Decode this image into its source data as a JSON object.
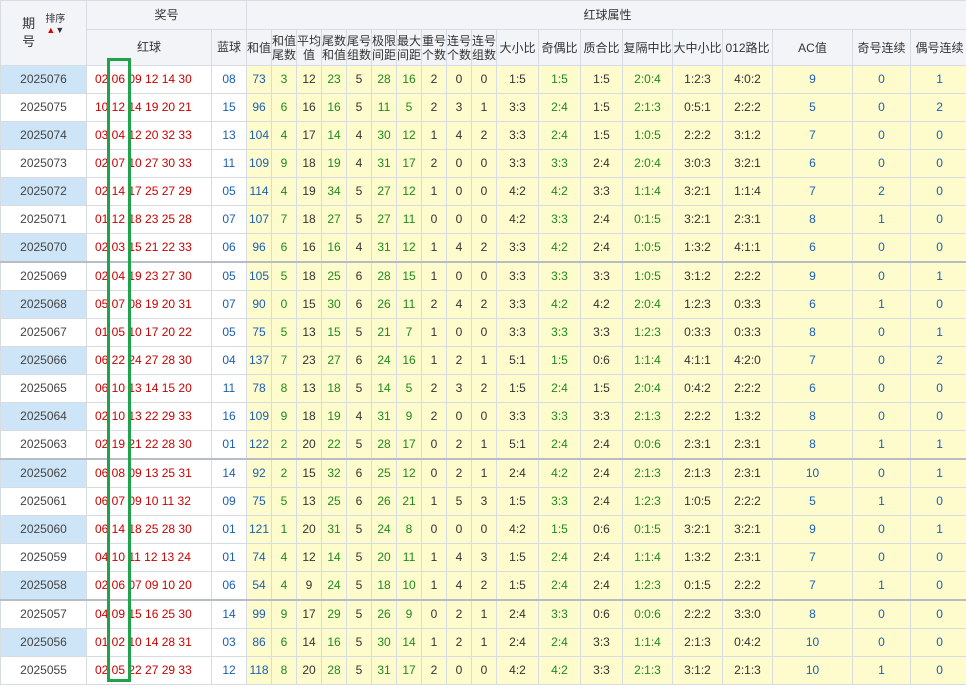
{
  "header": {
    "issue": "期号",
    "sort": "排序",
    "prize": "奖号",
    "red": "红球",
    "blue": "蓝球",
    "attr_group": "红球属性",
    "cols": [
      "和值",
      "和值尾数",
      "平均值",
      "尾数和值",
      "尾号组数",
      "极限间距",
      "最大间距",
      "重号个数",
      "连号个数",
      "连号组数",
      "大小比",
      "奇偶比",
      "质合比",
      "复隔中比",
      "大中小比",
      "012路比",
      "AC值",
      "奇号连续",
      "偶号连续"
    ]
  },
  "rows": [
    {
      "issue": "2025076",
      "red": "02 06 09 12 14 30",
      "blue": "08",
      "attrs": [
        "73",
        "3",
        "12",
        "23",
        "5",
        "28",
        "16",
        "2",
        "0",
        "0",
        "1:5",
        "1:5",
        "1:5",
        "2:0:4",
        "1:2:3",
        "4:0:2",
        "9",
        "0",
        "1"
      ]
    },
    {
      "issue": "2025075",
      "red": "10 12 14 19 20 21",
      "blue": "15",
      "attrs": [
        "96",
        "6",
        "16",
        "16",
        "5",
        "11",
        "5",
        "2",
        "3",
        "1",
        "3:3",
        "2:4",
        "1:5",
        "2:1:3",
        "0:5:1",
        "2:2:2",
        "5",
        "0",
        "2"
      ]
    },
    {
      "issue": "2025074",
      "red": "03 04 12 20 32 33",
      "blue": "13",
      "attrs": [
        "104",
        "4",
        "17",
        "14",
        "4",
        "30",
        "12",
        "1",
        "4",
        "2",
        "3:3",
        "2:4",
        "1:5",
        "1:0:5",
        "2:2:2",
        "3:1:2",
        "7",
        "0",
        "0"
      ]
    },
    {
      "issue": "2025073",
      "red": "02 07 10 27 30 33",
      "blue": "11",
      "attrs": [
        "109",
        "9",
        "18",
        "19",
        "4",
        "31",
        "17",
        "2",
        "0",
        "0",
        "3:3",
        "3:3",
        "2:4",
        "2:0:4",
        "3:0:3",
        "3:2:1",
        "6",
        "0",
        "0"
      ]
    },
    {
      "issue": "2025072",
      "red": "02 14 17 25 27 29",
      "blue": "05",
      "attrs": [
        "114",
        "4",
        "19",
        "34",
        "5",
        "27",
        "12",
        "1",
        "0",
        "0",
        "4:2",
        "4:2",
        "3:3",
        "1:1:4",
        "3:2:1",
        "1:1:4",
        "7",
        "2",
        "0"
      ]
    },
    {
      "issue": "2025071",
      "red": "01 12 18 23 25 28",
      "blue": "07",
      "attrs": [
        "107",
        "7",
        "18",
        "27",
        "5",
        "27",
        "11",
        "0",
        "0",
        "0",
        "4:2",
        "3:3",
        "2:4",
        "0:1:5",
        "3:2:1",
        "2:3:1",
        "8",
        "1",
        "0"
      ]
    },
    {
      "issue": "2025070",
      "red": "02 03 15 21 22 33",
      "blue": "06",
      "attrs": [
        "96",
        "6",
        "16",
        "16",
        "4",
        "31",
        "12",
        "1",
        "4",
        "2",
        "3:3",
        "4:2",
        "2:4",
        "1:0:5",
        "1:3:2",
        "4:1:1",
        "6",
        "0",
        "0"
      ]
    },
    {
      "issue": "2025069",
      "red": "02 04 19 23 27 30",
      "blue": "05",
      "attrs": [
        "105",
        "5",
        "18",
        "25",
        "6",
        "28",
        "15",
        "1",
        "0",
        "0",
        "3:3",
        "3:3",
        "3:3",
        "1:0:5",
        "3:1:2",
        "2:2:2",
        "9",
        "0",
        "1"
      ]
    },
    {
      "issue": "2025068",
      "red": "05 07 08 19 20 31",
      "blue": "07",
      "attrs": [
        "90",
        "0",
        "15",
        "30",
        "6",
        "26",
        "11",
        "2",
        "4",
        "2",
        "3:3",
        "4:2",
        "4:2",
        "2:0:4",
        "1:2:3",
        "0:3:3",
        "6",
        "1",
        "0"
      ]
    },
    {
      "issue": "2025067",
      "red": "01 05 10 17 20 22",
      "blue": "05",
      "attrs": [
        "75",
        "5",
        "13",
        "15",
        "5",
        "21",
        "7",
        "1",
        "0",
        "0",
        "3:3",
        "3:3",
        "3:3",
        "1:2:3",
        "0:3:3",
        "0:3:3",
        "8",
        "0",
        "1"
      ]
    },
    {
      "issue": "2025066",
      "red": "06 22 24 27 28 30",
      "blue": "04",
      "attrs": [
        "137",
        "7",
        "23",
        "27",
        "6",
        "24",
        "16",
        "1",
        "2",
        "1",
        "5:1",
        "1:5",
        "0:6",
        "1:1:4",
        "4:1:1",
        "4:2:0",
        "7",
        "0",
        "2"
      ]
    },
    {
      "issue": "2025065",
      "red": "06 10 13 14 15 20",
      "blue": "11",
      "attrs": [
        "78",
        "8",
        "13",
        "18",
        "5",
        "14",
        "5",
        "2",
        "3",
        "2",
        "1:5",
        "2:4",
        "1:5",
        "2:0:4",
        "0:4:2",
        "2:2:2",
        "6",
        "0",
        "0"
      ]
    },
    {
      "issue": "2025064",
      "red": "02 10 13 22 29 33",
      "blue": "16",
      "attrs": [
        "109",
        "9",
        "18",
        "19",
        "4",
        "31",
        "9",
        "2",
        "0",
        "0",
        "3:3",
        "3:3",
        "3:3",
        "2:1:3",
        "2:2:2",
        "1:3:2",
        "8",
        "0",
        "0"
      ]
    },
    {
      "issue": "2025063",
      "red": "02 19 21 22 28 30",
      "blue": "01",
      "attrs": [
        "122",
        "2",
        "20",
        "22",
        "5",
        "28",
        "17",
        "0",
        "2",
        "1",
        "5:1",
        "2:4",
        "2:4",
        "0:0:6",
        "2:3:1",
        "2:3:1",
        "8",
        "1",
        "1"
      ]
    },
    {
      "issue": "2025062",
      "red": "06 08 09 13 25 31",
      "blue": "14",
      "attrs": [
        "92",
        "2",
        "15",
        "32",
        "6",
        "25",
        "12",
        "0",
        "2",
        "1",
        "2:4",
        "4:2",
        "2:4",
        "2:1:3",
        "2:1:3",
        "2:3:1",
        "10",
        "0",
        "1"
      ]
    },
    {
      "issue": "2025061",
      "red": "06 07 09 10 11 32",
      "blue": "09",
      "attrs": [
        "75",
        "5",
        "13",
        "25",
        "6",
        "26",
        "21",
        "1",
        "5",
        "3",
        "1:5",
        "3:3",
        "2:4",
        "1:2:3",
        "1:0:5",
        "2:2:2",
        "5",
        "1",
        "0"
      ]
    },
    {
      "issue": "2025060",
      "red": "06 14 18 25 28 30",
      "blue": "01",
      "attrs": [
        "121",
        "1",
        "20",
        "31",
        "5",
        "24",
        "8",
        "0",
        "0",
        "0",
        "4:2",
        "1:5",
        "0:6",
        "0:1:5",
        "3:2:1",
        "3:2:1",
        "9",
        "0",
        "1"
      ]
    },
    {
      "issue": "2025059",
      "red": "04 10 11 12 13 24",
      "blue": "01",
      "attrs": [
        "74",
        "4",
        "12",
        "14",
        "5",
        "20",
        "11",
        "1",
        "4",
        "3",
        "1:5",
        "2:4",
        "2:4",
        "1:1:4",
        "1:3:2",
        "2:3:1",
        "7",
        "0",
        "0"
      ]
    },
    {
      "issue": "2025058",
      "red": "02 06 07 09 10 20",
      "blue": "06",
      "attrs": [
        "54",
        "4",
        "9",
        "24",
        "5",
        "18",
        "10",
        "1",
        "4",
        "2",
        "1:5",
        "2:4",
        "2:4",
        "1:2:3",
        "0:1:5",
        "2:2:2",
        "7",
        "1",
        "0"
      ]
    },
    {
      "issue": "2025057",
      "red": "04 09 15 16 25 30",
      "blue": "14",
      "attrs": [
        "99",
        "9",
        "17",
        "29",
        "5",
        "26",
        "9",
        "0",
        "2",
        "1",
        "2:4",
        "3:3",
        "0:6",
        "0:0:6",
        "2:2:2",
        "3:3:0",
        "8",
        "0",
        "0"
      ]
    },
    {
      "issue": "2025056",
      "red": "01 02 10 14 28 31",
      "blue": "03",
      "attrs": [
        "86",
        "6",
        "14",
        "16",
        "5",
        "30",
        "14",
        "1",
        "2",
        "1",
        "2:4",
        "2:4",
        "3:3",
        "1:1:4",
        "2:1:3",
        "0:4:2",
        "10",
        "0",
        "0"
      ]
    },
    {
      "issue": "2025055",
      "red": "02 05 22 27 29 33",
      "blue": "12",
      "attrs": [
        "118",
        "8",
        "20",
        "28",
        "5",
        "31",
        "17",
        "2",
        "0",
        "0",
        "4:2",
        "4:2",
        "3:3",
        "2:1:3",
        "3:1:2",
        "2:1:3",
        "10",
        "1",
        "0"
      ]
    }
  ],
  "separators_after": [
    "2025070",
    "2025063",
    "2025058"
  ],
  "colors": {
    "issue_stripe": "#cde5f7",
    "attr_bg": "#fefbcc",
    "red": "#cc0000",
    "blue": "#1a5fb4",
    "green": "#1e8a1e",
    "highlight": "#20a24a"
  }
}
